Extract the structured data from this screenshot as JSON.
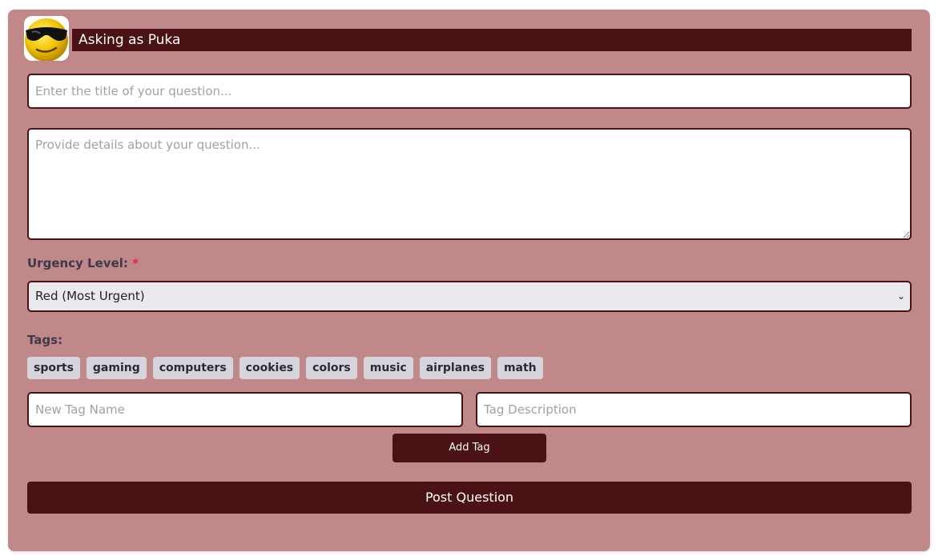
{
  "header": {
    "asking_as": "Asking as Puka",
    "avatar_icon": "sunglasses-smiley-icon"
  },
  "form": {
    "title_placeholder": "Enter the title of your question...",
    "details_placeholder": "Provide details about your question...",
    "urgency_label": "Urgency Level:",
    "urgency_required_mark": "*",
    "urgency_selected": "Red (Most Urgent)",
    "tags_label": "Tags:",
    "tags": [
      "sports",
      "gaming",
      "computers",
      "cookies",
      "colors",
      "music",
      "airplanes",
      "math"
    ],
    "new_tag_placeholder": "New Tag Name",
    "tag_description_placeholder": "Tag Description",
    "add_tag_label": "Add Tag",
    "post_label": "Post Question"
  },
  "colors": {
    "card_bg": "#c08888",
    "accent": "#4a1214",
    "required": "#e0245e",
    "tag_bg": "#d7d5dc"
  }
}
